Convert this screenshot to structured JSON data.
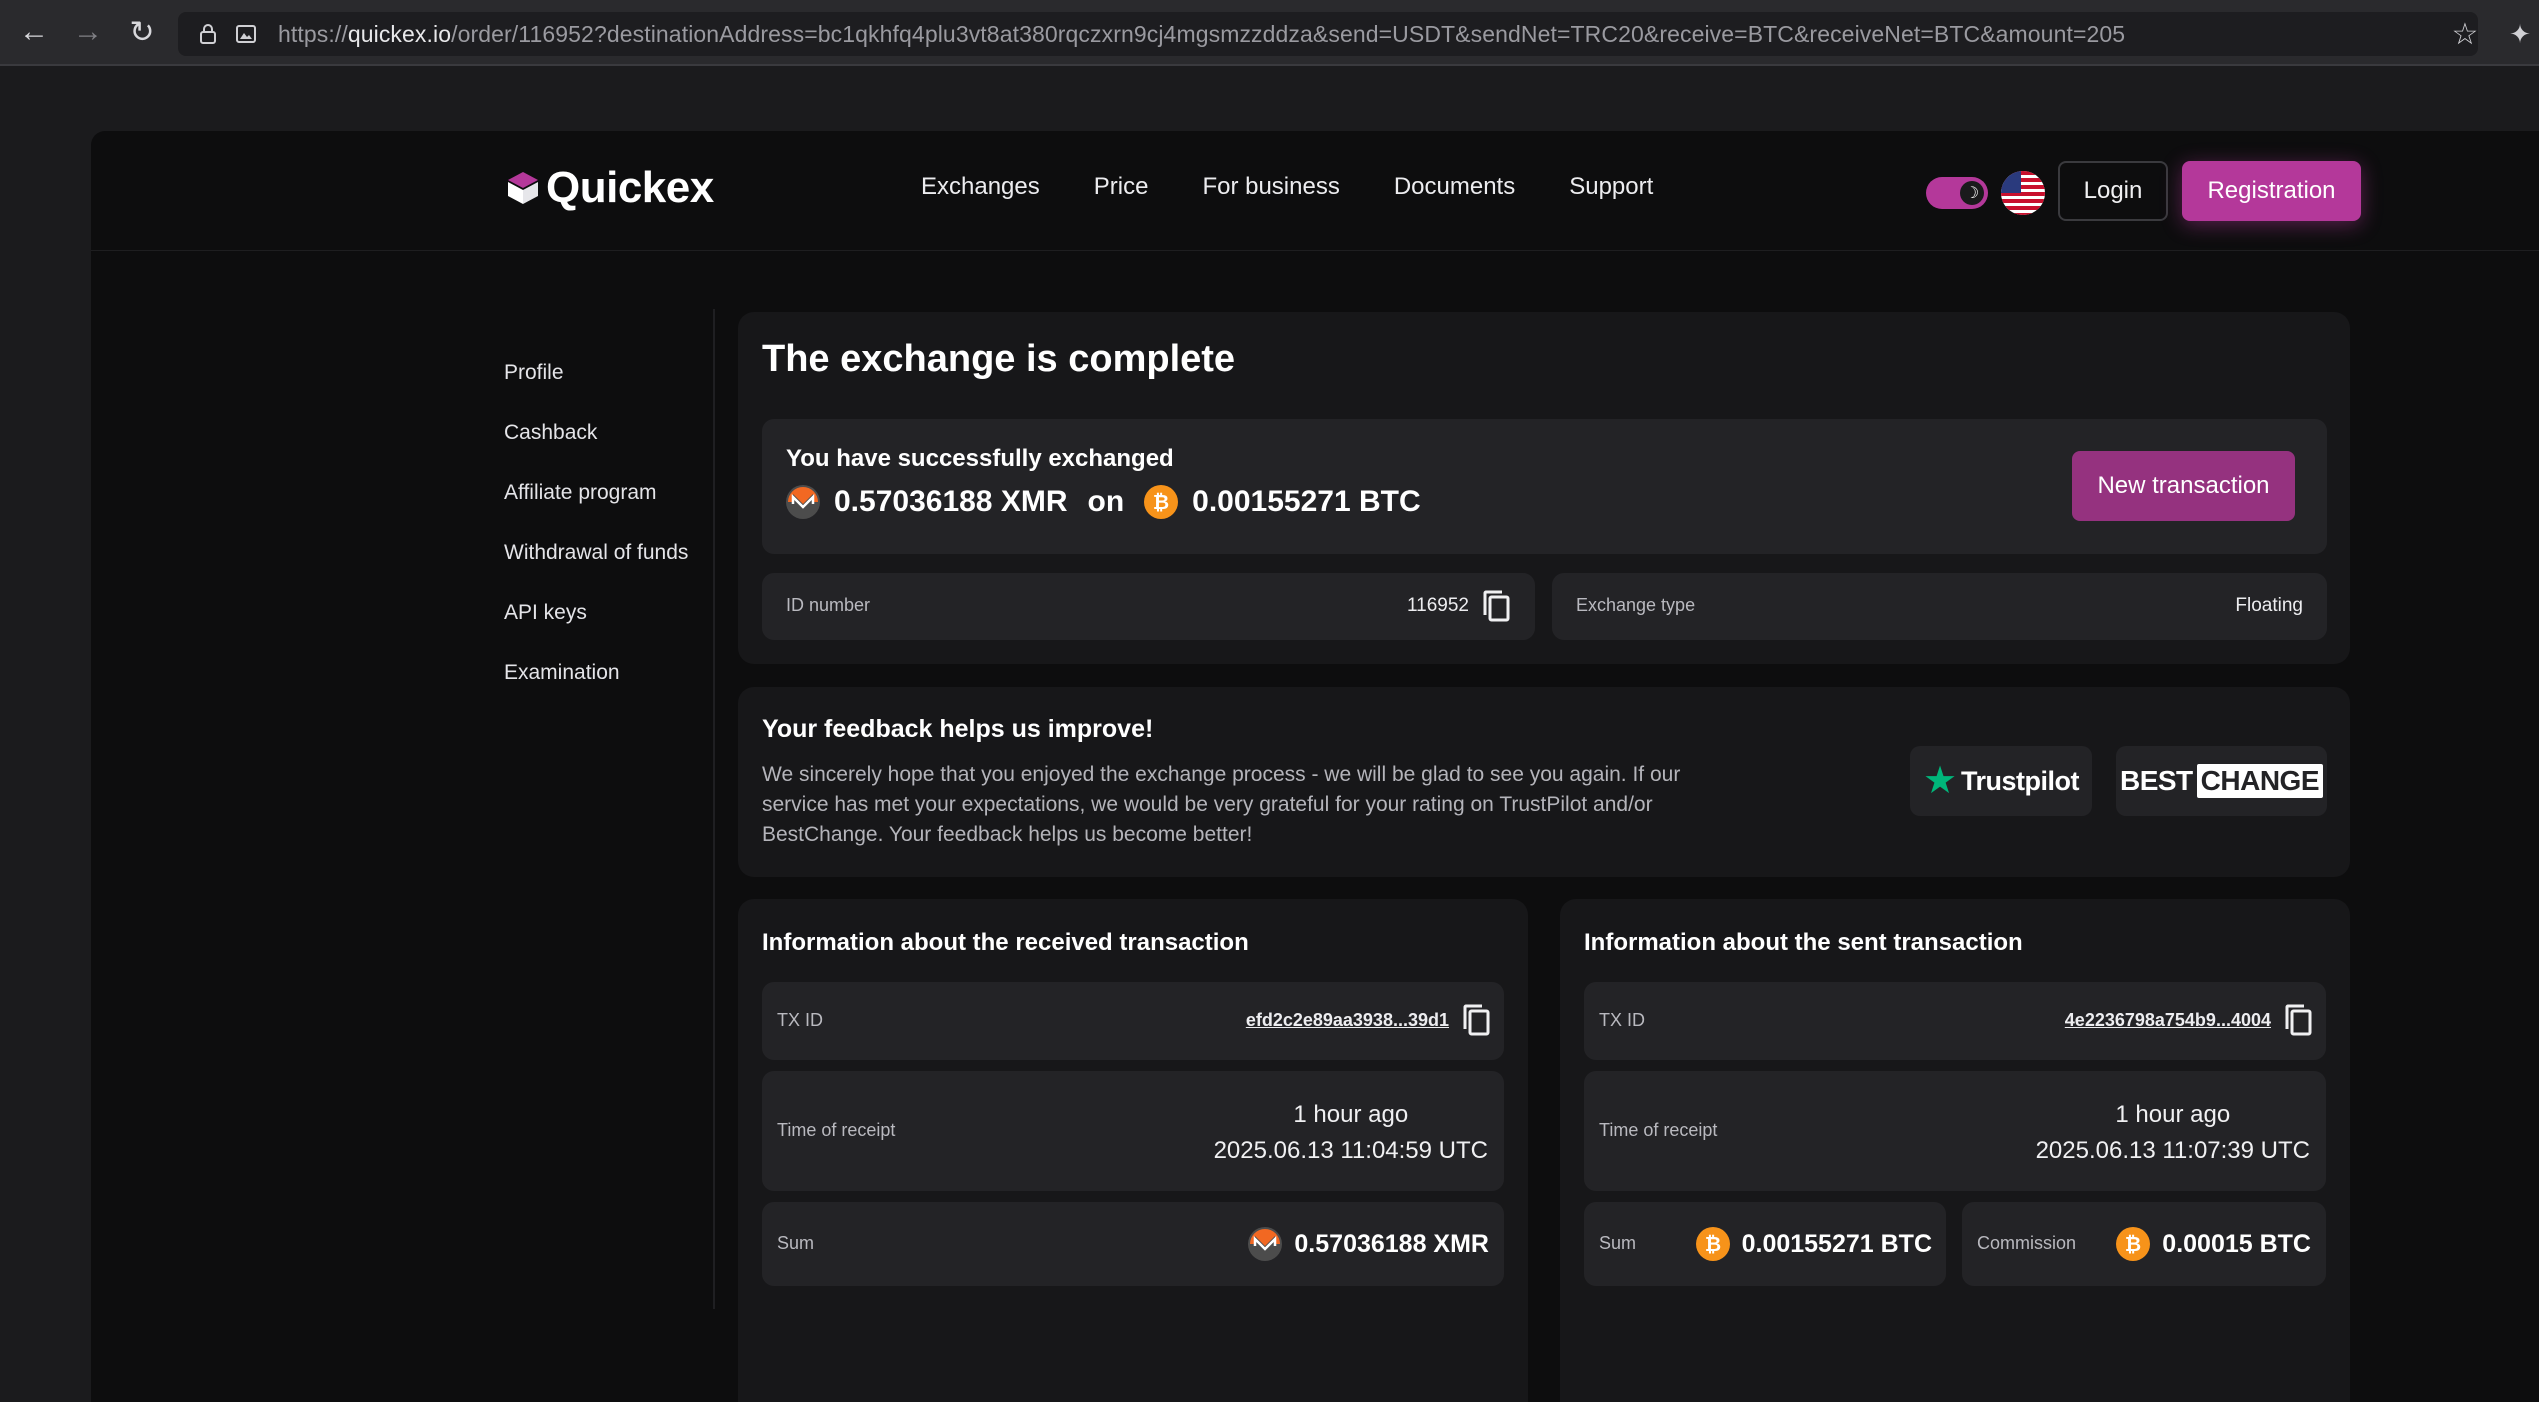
{
  "browser": {
    "url_scheme": "https://",
    "url_host": "quickex.io",
    "url_path": "/order/116952?destinationAddress=bc1qkhfq4plu3vt8at380rqczxrn9cj4mgsmzzddza&send=USDT&sendNet=TRC20&receive=BTC&receiveNet=BTC&amount=205"
  },
  "header": {
    "logo_text": "Quickex",
    "nav": [
      "Exchanges",
      "Price",
      "For business",
      "Documents",
      "Support"
    ],
    "login_label": "Login",
    "register_label": "Registration"
  },
  "sidebar": {
    "items": [
      "Profile",
      "Cashback",
      "Affiliate program",
      "Withdrawal of funds",
      "API keys",
      "Examination"
    ]
  },
  "exchange": {
    "title": "The exchange is complete",
    "success_label": "You have successfully exchanged",
    "sent_amount": "0.57036188 XMR",
    "connector": "on",
    "received_amount": "0.00155271 BTC",
    "new_transaction_label": "New transaction",
    "id_label": "ID number",
    "id_value": "116952",
    "type_label": "Exchange type",
    "type_value": "Floating"
  },
  "feedback": {
    "title": "Your feedback helps us improve!",
    "text": "We sincerely hope that you enjoyed the exchange process - we will be glad to see you again. If our service has met your expectations, we would be very grateful for your rating on TrustPilot and/or BestChange. Your feedback helps us become better!",
    "trustpilot_label": "Trustpilot",
    "bestchange_label_1": "BEST",
    "bestchange_label_2": "CHANGE"
  },
  "received_tx": {
    "title": "Information about the received transaction",
    "txid_label": "TX ID",
    "txid_value": "efd2c2e89aa3938...39d1",
    "time_label": "Time of receipt",
    "time_relative": "1 hour ago",
    "time_absolute": "2025.06.13 11:04:59 UTC",
    "sum_label": "Sum",
    "sum_value": "0.57036188 XMR"
  },
  "sent_tx": {
    "title": "Information about the sent transaction",
    "txid_label": "TX ID",
    "txid_value": "4e2236798a754b9...4004",
    "time_label": "Time of receipt",
    "time_relative": "1 hour ago",
    "time_absolute": "2025.06.13 11:07:39 UTC",
    "sum_label": "Sum",
    "sum_value": "0.00155271 BTC",
    "commission_label": "Commission",
    "commission_value": "0.00015 BTC"
  },
  "colors": {
    "accent": "#b4389a",
    "accent_dark": "#95327f",
    "btc": "#f7931a",
    "xmr": "#f26822",
    "trustpilot_green": "#00b67a"
  },
  "icons": [
    "back-arrow-icon",
    "forward-arrow-icon",
    "reload-icon",
    "lock-icon",
    "permissions-icon",
    "star-icon",
    "extension-icon",
    "moon-icon",
    "us-flag-icon",
    "xmr-coin-icon",
    "btc-coin-icon",
    "copy-icon",
    "trustpilot-star-icon"
  ]
}
